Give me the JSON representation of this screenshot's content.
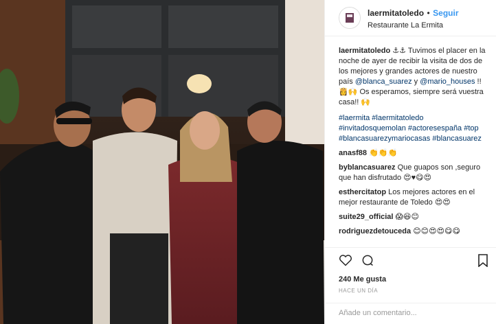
{
  "header": {
    "username": "laermitatoledo",
    "separator": "•",
    "follow_label": "Seguir",
    "location": "Restaurante La Ermita"
  },
  "caption": {
    "username": "laermitatoledo",
    "text_1": "⚓⚓ Tuvimos el placer en la noche de ayer de recibir la visita de dos de los mejores y grandes actores de nuestro país",
    "mention_1": "@blanca_suarez",
    "text_2": "y",
    "mention_2": "@mario_houses",
    "text_3": "!! 👸🙌 Os esperamos, siempre será vuestra casa!! 🙌",
    "hashtags_1": "#laermita #laermitatoledo #invitadosquemolan #actoresespaña #top #blancasuarezymariocasas #blancasuarez"
  },
  "comments": [
    {
      "user": "anasf88",
      "text": "👏👏👏"
    },
    {
      "user": "byblancasuarez",
      "text": "Que guapos son ,seguro que han disfrutado 😍♥😋😍"
    },
    {
      "user": "esthercitatop",
      "text": "Los mejores actores en el mejor restaurante de Toledo 😍😍"
    },
    {
      "user": "suite29_official",
      "text": "😱😆😊"
    },
    {
      "user": "rodriguezdetouceda",
      "text": "😊😊😍😍😋😋"
    }
  ],
  "actions": {
    "likes": "240 Me gusta",
    "time": "Hace un día",
    "add_comment_placeholder": "Añade un comentario..."
  },
  "icons": [
    "heart-icon",
    "comment-icon",
    "bookmark-icon"
  ],
  "colors": {
    "link": "#003569",
    "follow": "#3897f0",
    "text": "#262626",
    "muted": "#999999",
    "border": "#efefef"
  }
}
